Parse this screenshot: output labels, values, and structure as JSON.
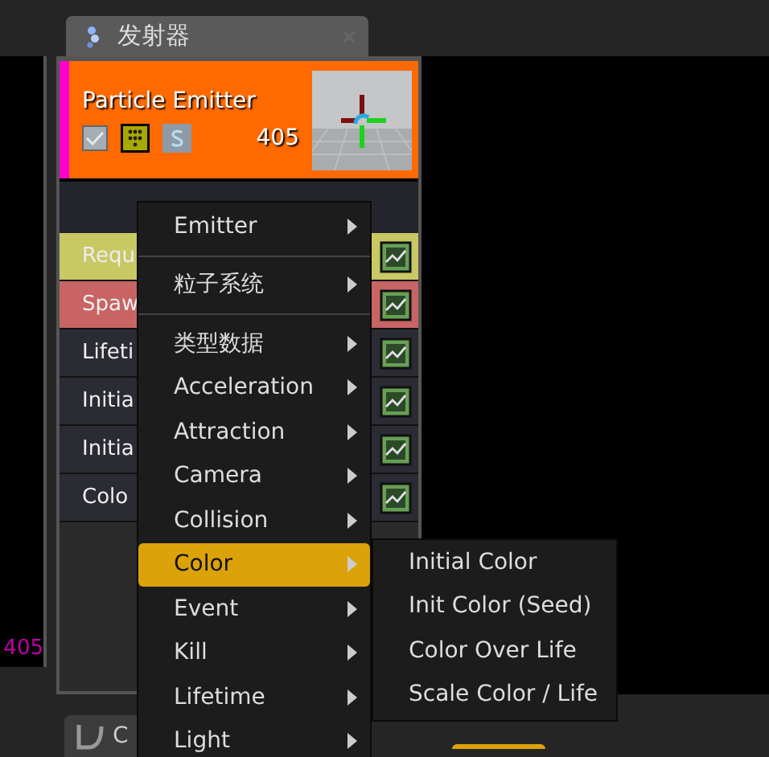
{
  "left_panel": {
    "count": "405"
  },
  "emitter_tab": {
    "title": "发射器"
  },
  "emitter": {
    "name": "Particle Emitter",
    "enabled": true,
    "count": "405",
    "color": "#ff00cc"
  },
  "modules": [
    {
      "label": "Requ",
      "color": "#c8c864"
    },
    {
      "label": "Spaw",
      "color": "#c86464"
    },
    {
      "label": "Lifeti",
      "color": "#2a2b33"
    },
    {
      "label": "Initia",
      "color": "#2a2b33"
    },
    {
      "label": "Initia",
      "color": "#2a2b33"
    },
    {
      "label": "Colo",
      "color": "#2a2b33"
    }
  ],
  "context_menu": {
    "items": [
      {
        "kind": "submenu",
        "label": "Emitter",
        "selected": false
      },
      {
        "kind": "separator"
      },
      {
        "kind": "submenu",
        "label": "粒子系统",
        "selected": false
      },
      {
        "kind": "separator"
      },
      {
        "kind": "submenu",
        "label": "类型数据",
        "selected": false
      },
      {
        "kind": "submenu",
        "label": "Acceleration",
        "selected": false
      },
      {
        "kind": "submenu",
        "label": "Attraction",
        "selected": false
      },
      {
        "kind": "submenu",
        "label": "Camera",
        "selected": false
      },
      {
        "kind": "submenu",
        "label": "Collision",
        "selected": false
      },
      {
        "kind": "submenu",
        "label": "Color",
        "selected": true
      },
      {
        "kind": "submenu",
        "label": "Event",
        "selected": false
      },
      {
        "kind": "submenu",
        "label": "Kill",
        "selected": false
      },
      {
        "kind": "submenu",
        "label": "Lifetime",
        "selected": false
      },
      {
        "kind": "submenu",
        "label": "Light",
        "selected": false
      }
    ]
  },
  "submenu": {
    "items": [
      {
        "label": "Initial Color",
        "selected": false
      },
      {
        "label": "Init Color (Seed)",
        "selected": false
      },
      {
        "label": "Color Over Life",
        "selected": false
      },
      {
        "label": "Scale Color / Life",
        "selected": false
      }
    ]
  },
  "bottom_tab": {
    "title": "C"
  }
}
